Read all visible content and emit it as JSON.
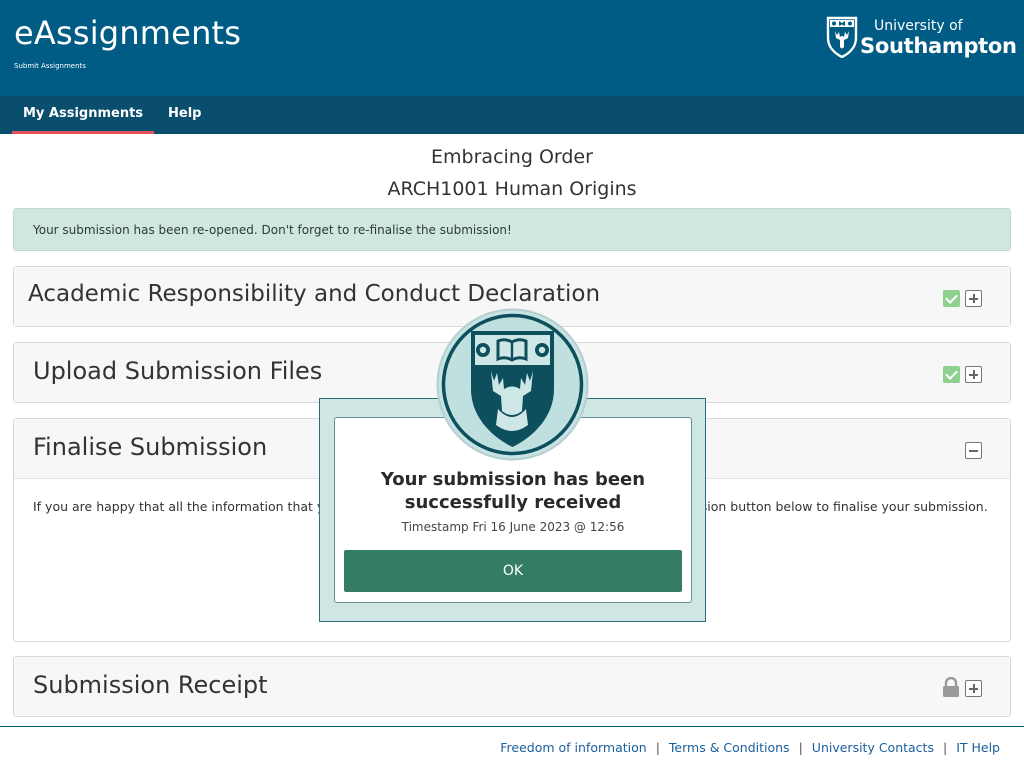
{
  "header": {
    "app_title": "eAssignments",
    "app_subtitle": "Submit Assignments",
    "logo_line1": "University of",
    "logo_line2": "Southampton",
    "logo_icon": "university-shield-icon",
    "background_color": "#005c84"
  },
  "nav": {
    "items": [
      {
        "label": "My Assignments",
        "active": true
      },
      {
        "label": "Help",
        "active": false
      }
    ],
    "active_underline_color": "#e8505b"
  },
  "assignment": {
    "title": "Embracing Order",
    "module": "ARCH1001 Human Origins"
  },
  "alert": {
    "text": "Your submission has been re-opened. Don't forget to re-finalise the submission!",
    "color": "#cfe7df"
  },
  "panels": [
    {
      "title": "Academic Responsibility and Conduct Declaration",
      "status_icon": "check-icon",
      "toggle_icon": "plus-box-icon"
    },
    {
      "title": "Upload Submission Files",
      "status_icon": "check-icon",
      "toggle_icon": "plus-box-icon"
    },
    {
      "title": "Finalise Submission",
      "toggle_icon": "minus-box-icon",
      "body_text": "If you are happy that all the information that you have provided is correct, please click the Finalise Submission button below to finalise your submission."
    },
    {
      "title": "Submission Receipt",
      "status_icon": "lock-icon",
      "toggle_icon": "plus-box-icon"
    }
  ],
  "modal": {
    "title": "Your submission has been successfully received",
    "timestamp": "Timestamp Fri 16 June 2023 @ 12:56",
    "ok_label": "OK",
    "crest_icon": "stag-crest-icon",
    "button_color": "#347d62"
  },
  "footer": {
    "links": [
      "Freedom of information",
      "Terms & Conditions",
      "University Contacts",
      "IT Help"
    ],
    "separator": "|"
  }
}
